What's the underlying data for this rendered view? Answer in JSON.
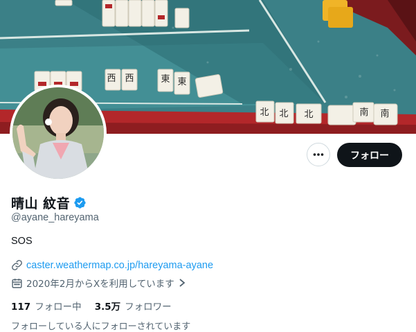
{
  "profile": {
    "display_name": "晴山 紋音",
    "handle": "@ayane_hareyama",
    "bio": "SOS",
    "website": "caster.weathermap.co.jp/hareyama-ayane",
    "joined": "2020年2月からXを利用しています",
    "verified": true
  },
  "actions": {
    "follow_label": "フォロー",
    "more_icon": "more-horizontal-icon"
  },
  "stats": {
    "following_count": "117",
    "following_label": "フォロー中",
    "followers_count": "3.5万",
    "followers_label": "フォロワー"
  },
  "cutoff_text": "フォローしている人にフォローされています",
  "icons": {
    "link": "link-icon",
    "calendar": "calendar-icon",
    "verified": "verified-badge-icon"
  },
  "colors": {
    "accent": "#1d9bf0",
    "text_primary": "#0f1419",
    "text_secondary": "#536471",
    "follow_button_bg": "#0f1419"
  }
}
